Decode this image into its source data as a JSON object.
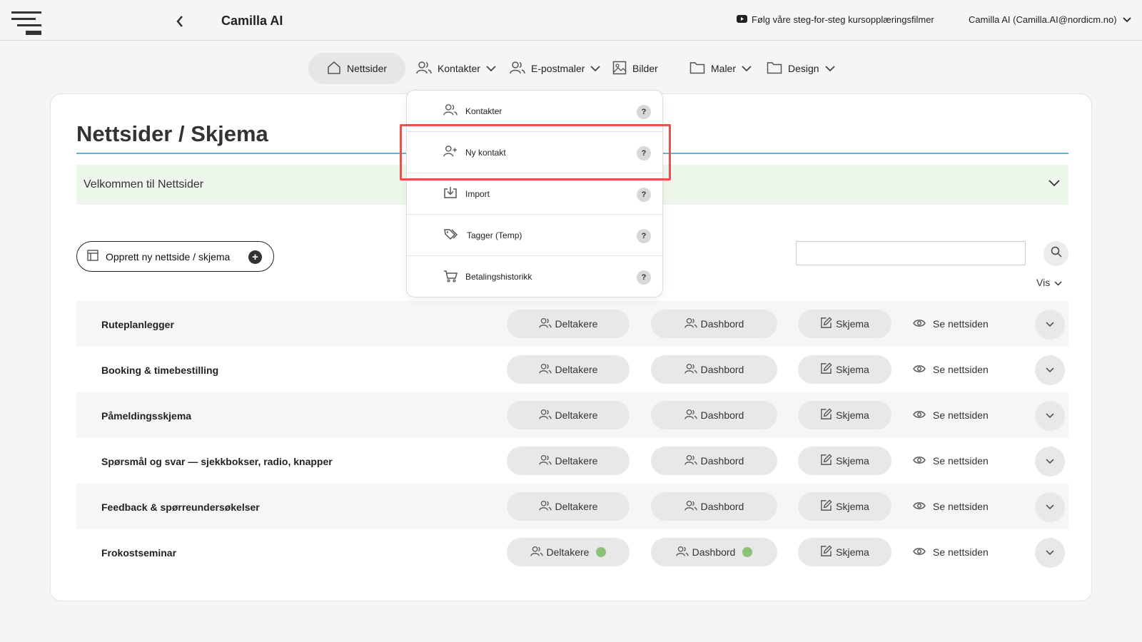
{
  "header": {
    "app_title": "Camilla AI",
    "tutorial_link": "Følg våre steg-for-steg kursopplæringsfilmer",
    "user_label": "Camilla AI (Camilla.AI@nordicm.no)"
  },
  "nav": {
    "items": [
      {
        "label": "Nettsider",
        "icon": "home-icon",
        "active": true
      },
      {
        "label": "Kontakter",
        "icon": "users-icon",
        "dropdown": true
      },
      {
        "label": "E-postmaler",
        "icon": "users-icon",
        "dropdown": true
      },
      {
        "label": "Bilder",
        "icon": "image-icon"
      },
      {
        "label": "Maler",
        "icon": "folder-icon",
        "dropdown": true
      },
      {
        "label": "Design",
        "icon": "folder-icon",
        "dropdown": true
      }
    ]
  },
  "dropdown": {
    "items": [
      {
        "label": "Kontakter",
        "icon": "users-icon",
        "help": "?"
      },
      {
        "label": "Ny kontakt",
        "icon": "user-plus-icon",
        "help": "?",
        "highlighted": true
      },
      {
        "label": "Import",
        "icon": "import-icon",
        "help": "?"
      },
      {
        "label": "Tagger (Temp)",
        "icon": "tags-icon",
        "help": "?"
      },
      {
        "label": "Betalingshistorikk",
        "icon": "cart-icon",
        "help": "?"
      }
    ]
  },
  "main": {
    "title": "Nettsider / Skjema",
    "welcome": "Velkommen til Nettsider",
    "create_button": "Opprett ny nettside / skjema",
    "create_plus": "+",
    "search_placeholder": "",
    "view_label": "Vis"
  },
  "row_actions": {
    "participants": "Deltakere",
    "dashboard": "Dashbord",
    "form": "Skjema",
    "view": "Se nettsiden"
  },
  "rows": [
    {
      "name": "Ruteplanlegger",
      "status_dot": false
    },
    {
      "name": "Booking & timebestilling",
      "status_dot": false
    },
    {
      "name": "Påmeldingsskjema",
      "status_dot": false
    },
    {
      "name": "Spørsmål og svar — sjekkbokser, radio, knapper",
      "status_dot": false
    },
    {
      "name": "Feedback & spørreundersøkelser",
      "status_dot": false
    },
    {
      "name": "Frokostseminar",
      "status_dot": true
    }
  ],
  "colors": {
    "accent_rule": "#5bb8d4",
    "welcome_bg": "#edf6eb",
    "status_dot": "#8cc277",
    "highlight": "#e8524a"
  }
}
